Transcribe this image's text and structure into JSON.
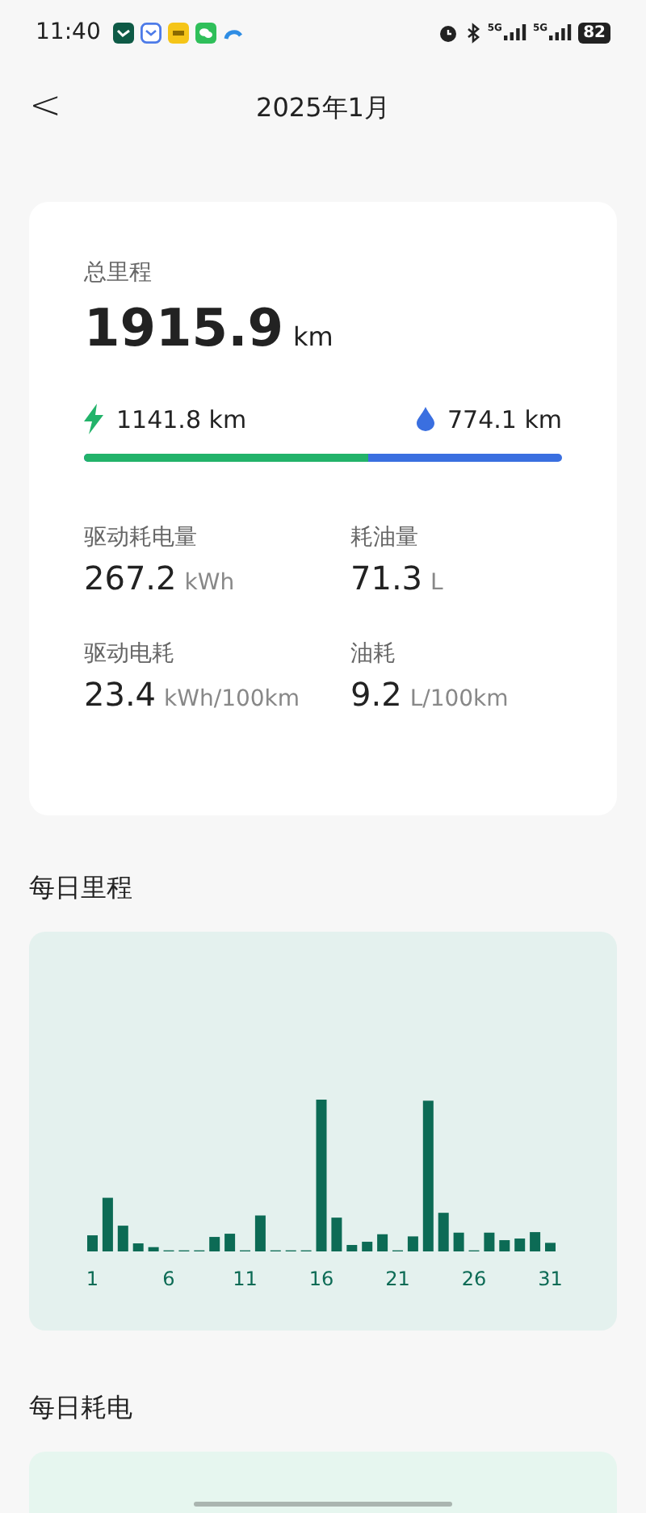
{
  "status_bar": {
    "time": "11:40",
    "network_labels": [
      "5G",
      "5G"
    ],
    "battery": "82"
  },
  "header": {
    "back": "<",
    "title": "2025年1月"
  },
  "summary": {
    "label": "总里程",
    "value": "1915.9",
    "unit": "km",
    "electric": {
      "value": "1141.8",
      "unit": "km"
    },
    "fuel": {
      "value": "774.1",
      "unit": "km"
    },
    "level": 0.596,
    "stats": [
      {
        "label": "驱动耗电量",
        "value": "267.2",
        "unit": "kWh"
      },
      {
        "label": "耗油量",
        "value": "71.3",
        "unit": "L"
      },
      {
        "label": "驱动电耗",
        "value": "23.4",
        "unit": "kWh/100km"
      },
      {
        "label": "油耗",
        "value": "9.2",
        "unit": "L/100km"
      }
    ]
  },
  "daily_mileage": {
    "title": "每日里程",
    "x_labels": [
      "1",
      "6",
      "11",
      "16",
      "21",
      "26",
      "31"
    ]
  },
  "daily_power": {
    "title": "每日耗电"
  }
}
